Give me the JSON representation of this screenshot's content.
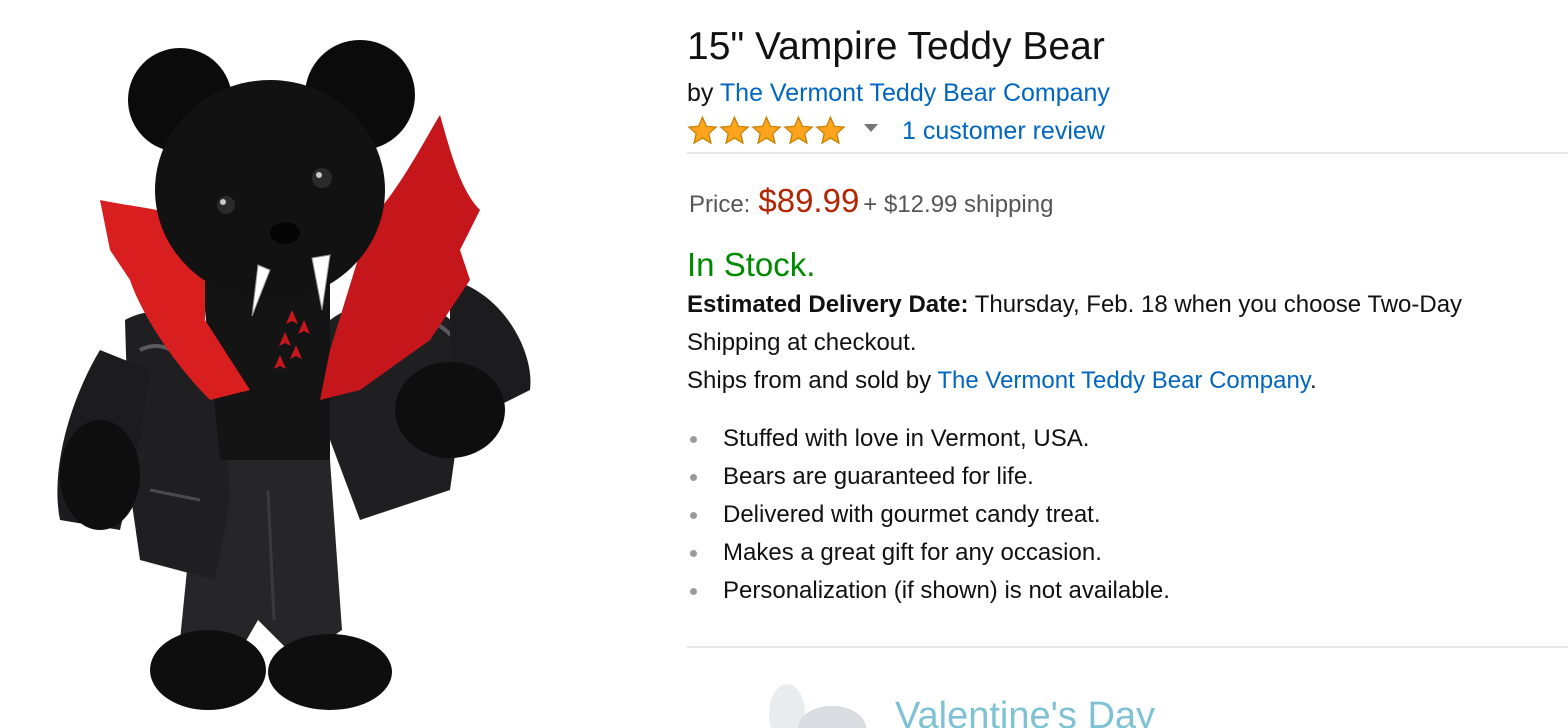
{
  "product": {
    "title": "15\" Vampire Teddy Bear",
    "by_label": "by",
    "brand": "The Vermont Teddy Bear Company",
    "rating": {
      "value": 5,
      "max": 5
    },
    "review_link": "1 customer review",
    "price_label": "Price:",
    "price": "$89.99",
    "shipping": "+ $12.99 shipping",
    "availability": "In Stock.",
    "delivery_label": "Estimated Delivery Date:",
    "delivery_text": "Thursday, Feb. 18 when you choose Two-Day Shipping at checkout.",
    "ships_from_prefix": "Ships from and sold by",
    "seller": "The Vermont Teddy Bear Company",
    "ships_from_suffix": ".",
    "features": [
      "Stuffed with love in Vermont, USA.",
      "Bears are guaranteed for life.",
      "Delivered with gourmet candy treat.",
      "Makes a great gift for any occasion.",
      "Personalization (if shown) is not available."
    ]
  },
  "promo": {
    "text": "Valentine's Day"
  },
  "colors": {
    "link": "#0066c0",
    "price": "#b12704",
    "in_stock": "#008a00",
    "star": "#ffa41c",
    "promo_text": "#7ec2d4"
  }
}
